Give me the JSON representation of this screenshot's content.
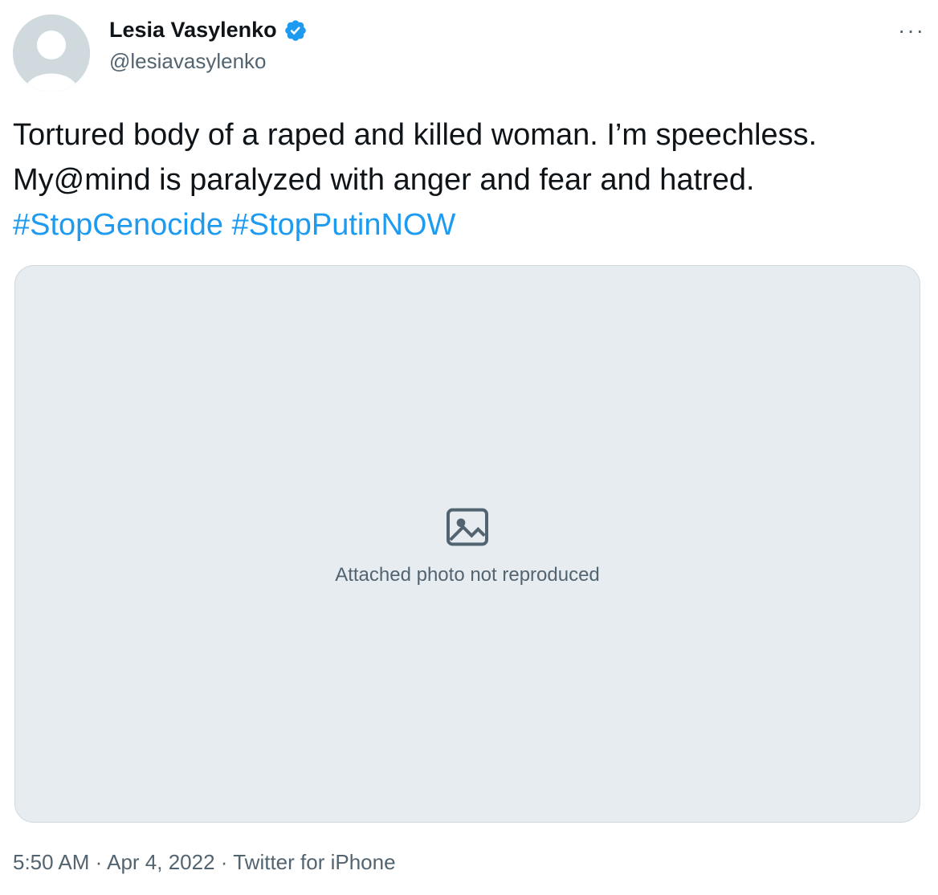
{
  "author": {
    "display_name": "Lesia Vasylenko",
    "handle": "@lesiavasylenko",
    "verified": true
  },
  "tweet": {
    "text_plain": "Tortured body of a raped and killed woman. I’m speechless. My@mind is paralyzed with anger and fear and hatred.",
    "hashtag_1": "#StopGenocide",
    "hashtag_2": "#StopPutinNOW"
  },
  "meta": {
    "time": "5:50 AM",
    "date": "Apr 4, 2022",
    "source": "Twitter for iPhone",
    "separator": "·"
  },
  "icons": {
    "verified": "verified-badge-icon",
    "more": "more-horizontal-icon"
  },
  "colors": {
    "accent": "#1d9bf0",
    "secondary_text": "#536471"
  }
}
